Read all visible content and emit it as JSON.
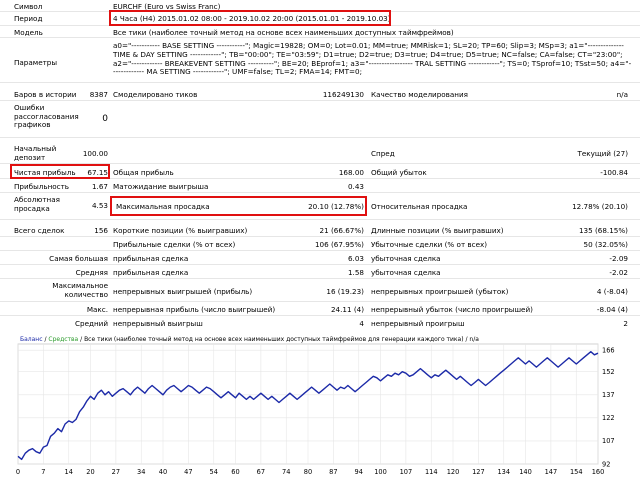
{
  "header": {
    "symbol": {
      "label": "Символ",
      "value": "EURCHF (Euro vs Swiss Franc)"
    },
    "period": {
      "label": "Период",
      "value": "4 Часа (H4) 2015.01.02 08:00 - 2019.10.02 20:00 (2015.01.01 - 2019.10.03)"
    },
    "model": {
      "label": "Модель",
      "value": "Все тики (наиболее точный метод на основе всех наименьших доступных таймфреймов)"
    },
    "params": {
      "label": "Параметры",
      "value": "a0=\"----------- BASE SETTING -----------\"; Magic=19828; OM=0; Lot=0.01; MM=true; MMRisk=1; SL=20; TP=60; Slip=3; MSp=3; a1=\"-------------- TIME & DAY SETTING ------------\"; TB=\"00:00\"; TE=\"03:59\"; D1=true; D2=true; D3=true; D4=true; D5=true; NC=false; CA=false; CT=\"23:00\"; a2=\"------------ BREAKEVENT SETTING ----------\"; BE=20; BEprof=1; a3=\"----------------- TRAL SETTING ------------\"; TS=0; TSprof=10; TSst=50; a4=\"------------- MA SETTING ------------\"; UMF=false; TL=2; FMA=14; FMT=0;"
    }
  },
  "bars": {
    "label": "Баров в истории",
    "value": "8387"
  },
  "ticks": {
    "label": "Смоделировано тиков",
    "value": "116249130"
  },
  "quality": {
    "label": "Качество моделирования",
    "value": "n/a"
  },
  "errors": {
    "label": "Ошибки рассогласования графиков",
    "value": "0"
  },
  "deposit": {
    "label": "Начальный депозит",
    "value": "100.00"
  },
  "spread": {
    "label": "Спред",
    "value": "Текущий (27)"
  },
  "net_profit": {
    "label": "Чистая прибыль",
    "value": "67.15"
  },
  "gross_profit": {
    "label": "Общая прибыль",
    "value": "168.00"
  },
  "gross_loss": {
    "label": "Общий убыток",
    "value": "-100.84"
  },
  "profit_factor": {
    "label": "Прибыльность",
    "value": "1.67"
  },
  "expected_payoff": {
    "label": "Матожидание выигрыша",
    "value": "0.43"
  },
  "abs_drawdown": {
    "label": "Абсолютная просадка",
    "value": "4.53"
  },
  "max_drawdown": {
    "label": "Максимальная просадка",
    "value": "20.10 (12.78%)"
  },
  "rel_drawdown": {
    "label": "Относительная просадка",
    "value": "12.78% (20.10)"
  },
  "total_trades": {
    "label": "Всего сделок",
    "value": "156"
  },
  "short_pos": {
    "label": "Короткие позиции (% выигравших)",
    "value": "21 (66.67%)"
  },
  "long_pos": {
    "label": "Длинные позиции (% выигравших)",
    "value": "135 (68.15%)"
  },
  "profit_trades": {
    "label": "Прибыльные сделки (% от всех)",
    "value": "106 (67.95%)"
  },
  "loss_trades": {
    "label": "Убыточные сделки (% от всех)",
    "value": "50 (32.05%)"
  },
  "largest": {
    "label": "Самая большая",
    "pt_label": "прибыльная сделка",
    "pt_value": "6.03",
    "lt_label": "убыточная сделка",
    "lt_value": "-2.09"
  },
  "average": {
    "label": "Средняя",
    "pt_label": "прибыльная сделка",
    "pt_value": "1.58",
    "lt_label": "убыточная сделка",
    "lt_value": "-2.02"
  },
  "maximum": {
    "label": "Максимальное количество",
    "w_label": "непрерывных выигрышей (прибыль)",
    "w_value": "16 (19.23)",
    "l_label": "непрерывных проигрышей (убыток)",
    "l_value": "4 (-8.04)"
  },
  "maximal": {
    "label": "Макс.",
    "w_label": "непрерывная прибыль (число выигрышей)",
    "w_value": "24.11 (4)",
    "l_label": "непрерывный убыток (число проигрышей)",
    "l_value": "-8.04 (4)"
  },
  "avg_consec": {
    "label": "Средний",
    "w_label": "непрерывный выигрыш",
    "w_value": "4",
    "l_label": "непрерывный проигрыш",
    "l_value": "2"
  },
  "chart_legend": {
    "balance": "Баланс",
    "sep1": " / ",
    "equity": "Средства",
    "rest": " / Все тики (наиболее точный метод на основе всех наименьших доступных таймфреймов для генерации каждого тика) / n/a"
  },
  "colors": {
    "highlight": "#e01010",
    "line": "#1c2aa8",
    "balance_label": "#1c2aa8",
    "equity_label": "#2a9a2a",
    "grid": "#e6e6e6"
  },
  "chart_data": {
    "type": "line",
    "xlim": [
      0,
      160
    ],
    "ylim": [
      92,
      170
    ],
    "x_ticks": [
      0,
      7,
      14,
      20,
      27,
      34,
      40,
      47,
      54,
      60,
      67,
      74,
      80,
      87,
      94,
      100,
      107,
      114,
      120,
      127,
      134,
      140,
      147,
      154,
      160
    ],
    "y_ticks": [
      92,
      107,
      122,
      137,
      152,
      166
    ],
    "series": [
      {
        "values": [
          97,
          95,
          99,
          101,
          102,
          100,
          99,
          103,
          104,
          110,
          112,
          115,
          113,
          118,
          120,
          119,
          121,
          126,
          129,
          133,
          136,
          134,
          138,
          140,
          137,
          139,
          136,
          138,
          140,
          141,
          139,
          137,
          140,
          142,
          140,
          138,
          141,
          143,
          141,
          139,
          137,
          140,
          142,
          143,
          141,
          139,
          141,
          143,
          142,
          140,
          138,
          140,
          142,
          141,
          139,
          137,
          135,
          137,
          139,
          137,
          135,
          138,
          136,
          134,
          136,
          134,
          136,
          138,
          136,
          134,
          136,
          134,
          132,
          134,
          136,
          138,
          136,
          134,
          136,
          138,
          140,
          142,
          140,
          138,
          140,
          142,
          144,
          142,
          140,
          142,
          141,
          143,
          141,
          139,
          141,
          143,
          145,
          147,
          149,
          148,
          146,
          148,
          150,
          149,
          151,
          150,
          152,
          151,
          149,
          150,
          152,
          154,
          152,
          150,
          148,
          150,
          149,
          151,
          153,
          151,
          149,
          147,
          149,
          147,
          145,
          143,
          145,
          147,
          145,
          143,
          145,
          147,
          149,
          151,
          153,
          155,
          157,
          159,
          161,
          159,
          157,
          159,
          157,
          155,
          157,
          159,
          161,
          159,
          157,
          155,
          157,
          159,
          161,
          159,
          157,
          159,
          161,
          163,
          165,
          163,
          164
        ]
      }
    ]
  }
}
